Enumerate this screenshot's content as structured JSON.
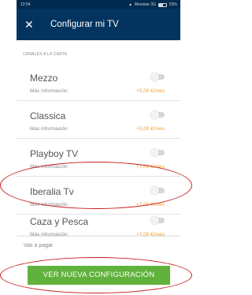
{
  "status_bar": {
    "time": "12:54",
    "carrier": "Movistar 3G",
    "battery": "53%"
  },
  "header": {
    "close_icon": "close-icon",
    "title": "Configurar mi TV"
  },
  "section": {
    "label": "CANALES A LA CARTA"
  },
  "channels": [
    {
      "name": "Mezzo",
      "info": "Más información",
      "price": "+5,00 €/mes",
      "enabled": false
    },
    {
      "name": "Classica",
      "info": "Más información",
      "price": "+5,00 €/mes",
      "enabled": false
    },
    {
      "name": "Playboy TV",
      "info": "Más información",
      "price": "+7,00 €/mes",
      "enabled": false
    },
    {
      "name": "Iberalia Tv",
      "info": "Más información",
      "price": "+7,00 €/mes",
      "enabled": false
    },
    {
      "name": "Caza y Pesca",
      "info": "Más información",
      "price": "+7,00 €/mes",
      "enabled": false
    }
  ],
  "footer": {
    "pay_label": "Vas a pagar",
    "button_label": "VER NUEVA CONFIGURACIÓN"
  },
  "colors": {
    "header": "#02345f",
    "button": "#60b23c",
    "price": "#f0a030",
    "annotation": "#c81e1e"
  }
}
